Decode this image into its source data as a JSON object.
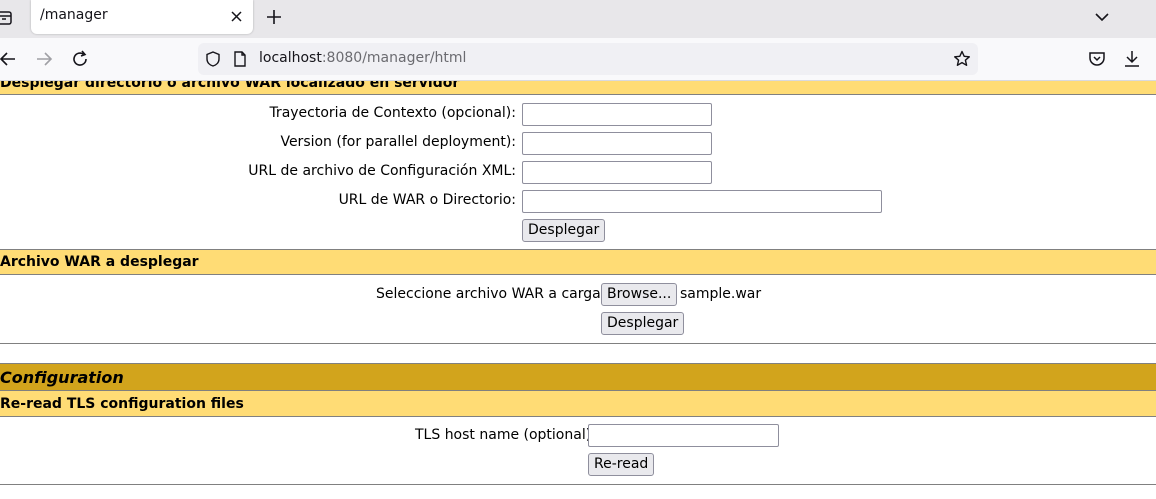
{
  "browser": {
    "tab_title": "/manager",
    "url_host": "localhost",
    "url_rest": ":8080/manager/html",
    "icons": [
      "tab-list-icon",
      "close-icon",
      "plus-icon",
      "chevron-down-icon",
      "back-arrow-icon",
      "forward-arrow-icon",
      "reload-icon",
      "shield-icon",
      "page-icon",
      "star-icon",
      "pocket-icon",
      "download-icon"
    ]
  },
  "deploy_dir": {
    "heading": "Desplegar directorio o archivo WAR localizado en servidor",
    "context_path_label": "Trayectoria de Contexto (opcional):",
    "context_path_value": "",
    "version_label": "Version (for parallel deployment):",
    "version_value": "",
    "config_url_label": "URL de archivo de Configuración XML:",
    "config_url_value": "",
    "war_url_label": "URL de WAR o Directorio:",
    "war_url_value": "",
    "deploy_button": "Desplegar"
  },
  "upload_war": {
    "heading": "Archivo WAR a desplegar",
    "select_label": "Seleccione archivo WAR a cargar",
    "browse_button": "Browse...",
    "file_name": "sample.war",
    "deploy_button": "Desplegar"
  },
  "configuration": {
    "heading": "Configuration",
    "tls_heading": "Re-read TLS configuration files",
    "tls_host_label": "TLS host name (optional)",
    "tls_host_value": "",
    "reread_button": "Re-read"
  },
  "colors": {
    "section_header": "#ffdc75",
    "configuration_header": "#d2a41c"
  }
}
